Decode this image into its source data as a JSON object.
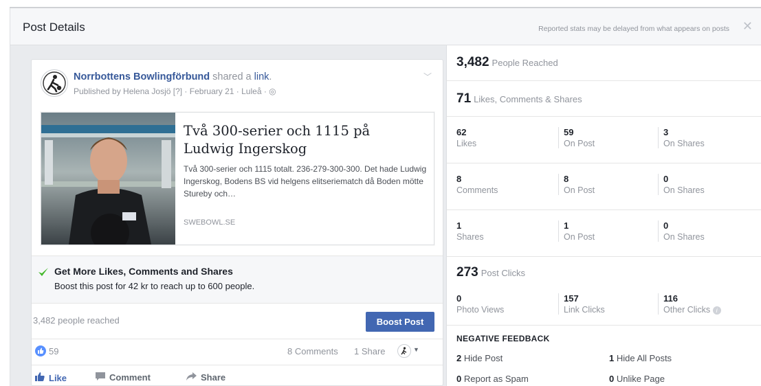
{
  "header": {
    "title": "Post Details",
    "note": "Reported stats may be delayed from what appears on posts",
    "close_glyph": "✕"
  },
  "post": {
    "page_name": "Norrbottens Bowlingförbund",
    "action_text": " shared a ",
    "link_word": "link",
    "period": ".",
    "meta": "Published by Helena Josjö [?] · February 21 · Luleå · ◎",
    "link": {
      "title": "Två 300-serier och 1115 på Ludwig Ingerskog",
      "description": "Två 300-serier och 1115 totalt. 236-279-300-300. Det hade Ludwig Ingerskog, Bodens BS vid helgens elitseriematch då Boden mötte Stureby och…",
      "source": "SWEBOWL.SE"
    },
    "boost": {
      "heading": "Get More Likes, Comments and Shares",
      "text": "Boost this post for 42 kr to reach up to 600 people."
    },
    "reach_text": "3,482 people reached",
    "boost_button": "Boost Post",
    "likes_count": "59",
    "comments_text": "8 Comments",
    "shares_text": "1 Share",
    "actions": {
      "like": "Like",
      "comment": "Comment",
      "share": "Share"
    }
  },
  "stats": {
    "reached": {
      "value": "3,482",
      "label": "People Reached"
    },
    "engagement": {
      "value": "71",
      "label": "Likes, Comments & Shares"
    },
    "rows": [
      [
        {
          "n": "62",
          "l": "Likes"
        },
        {
          "n": "59",
          "l": "On Post"
        },
        {
          "n": "3",
          "l": "On Shares"
        }
      ],
      [
        {
          "n": "8",
          "l": "Comments"
        },
        {
          "n": "8",
          "l": "On Post"
        },
        {
          "n": "0",
          "l": "On Shares"
        }
      ],
      [
        {
          "n": "1",
          "l": "Shares"
        },
        {
          "n": "1",
          "l": "On Post"
        },
        {
          "n": "0",
          "l": "On Shares"
        }
      ]
    ],
    "clicks": {
      "value": "273",
      "label": "Post Clicks"
    },
    "click_rows": [
      {
        "n": "0",
        "l": "Photo Views"
      },
      {
        "n": "157",
        "l": "Link Clicks"
      },
      {
        "n": "116",
        "l": "Other Clicks"
      }
    ],
    "negative": {
      "heading": "NEGATIVE FEEDBACK",
      "items": [
        {
          "n": "2",
          "l": "Hide Post"
        },
        {
          "n": "1",
          "l": "Hide All Posts"
        },
        {
          "n": "0",
          "l": "Report as Spam"
        },
        {
          "n": "0",
          "l": "Unlike Page"
        }
      ]
    }
  },
  "colors": {
    "link_blue": "#365899",
    "boost_blue": "#4267b2",
    "like_blue": "#5890ff",
    "check_green": "#42b72a"
  }
}
